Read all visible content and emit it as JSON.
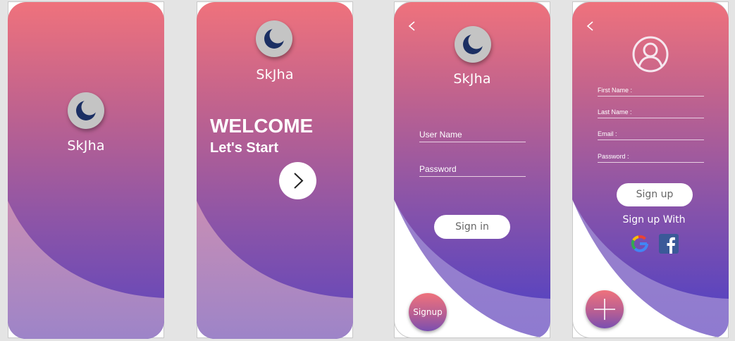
{
  "screens": {
    "splash": {
      "brand": "SkJha"
    },
    "welcome": {
      "brand": "SkJha",
      "title": "WELCOME",
      "subtitle": "Let's Start"
    },
    "signin": {
      "brand": "SkJha",
      "username_label": "User Name",
      "password_label": "Password",
      "signin_label": "Sign in",
      "signup_label": "Signup"
    },
    "signup": {
      "first_name_label": "First Name :",
      "last_name_label": "Last Name :",
      "email_label": "Email :",
      "password_label": "Password :",
      "signup_label": "Sign up",
      "signup_with_label": "Sign up With"
    }
  },
  "icons": {
    "logo": "crescent-moon-icon",
    "next": "chevron-right-icon",
    "back": "chevron-left-icon",
    "user": "user-circle-icon",
    "google": "google-icon",
    "facebook": "facebook-icon",
    "add": "plus-icon"
  },
  "colors": {
    "gradient_top": "#ef727c",
    "gradient_bottom": "#5c45be",
    "moon": "#1b2f63"
  }
}
